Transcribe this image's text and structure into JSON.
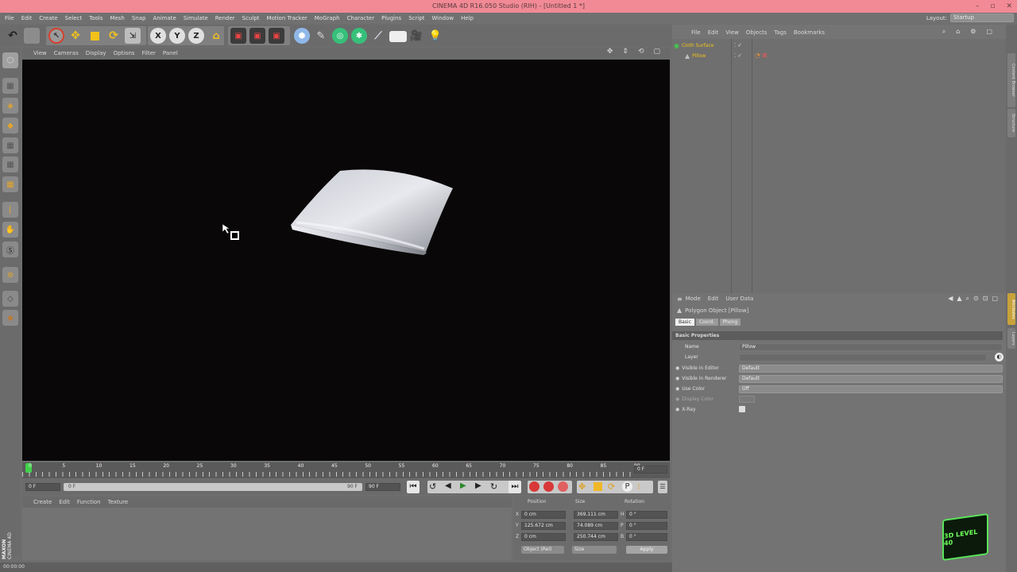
{
  "titlebar": {
    "title": "CINEMA 4D R16.050 Studio (RIH) - [Untitled 1 *]"
  },
  "window_buttons": [
    "–",
    "▫",
    "✕"
  ],
  "menubar": [
    "File",
    "Edit",
    "Create",
    "Select",
    "Tools",
    "Mesh",
    "Snap",
    "Animate",
    "Simulate",
    "Render",
    "Sculpt",
    "Motion Tracker",
    "MoGraph",
    "Character",
    "Plugins",
    "Script",
    "Window",
    "Help"
  ],
  "layout": {
    "label": "Layout:",
    "value": "Startup"
  },
  "toolbar": {
    "undo_icon": "undo-icon",
    "axis_labels": [
      "X",
      "Y",
      "Z"
    ]
  },
  "viewport_menu": [
    "View",
    "Cameras",
    "Display",
    "Options",
    "Filter",
    "Panel"
  ],
  "timeline": {
    "ticks": [
      "0",
      "5",
      "10",
      "15",
      "20",
      "25",
      "30",
      "35",
      "40",
      "45",
      "50",
      "55",
      "60",
      "65",
      "70",
      "75",
      "80",
      "85",
      "90"
    ],
    "end_label": "0 F"
  },
  "anim": {
    "start": "0 F",
    "range_start": "0 F",
    "range_end": "90 F",
    "end": "90 F"
  },
  "material_menu": [
    "Create",
    "Edit",
    "Function",
    "Texture"
  ],
  "coords": {
    "headers": [
      "Position",
      "Size",
      "Rotation"
    ],
    "rows": [
      {
        "axis": "X",
        "pos": "0 cm",
        "size": "369.111 cm",
        "rot_axis": "H",
        "rot": "0 °"
      },
      {
        "axis": "Y",
        "pos": "125.672 cm",
        "size": "74.089 cm",
        "rot_axis": "P",
        "rot": "0 °"
      },
      {
        "axis": "Z",
        "pos": "0 cm",
        "size": "250.744 cm",
        "rot_axis": "B",
        "rot": "0 °"
      }
    ],
    "mode1": "Object (Rel)",
    "mode2": "Size",
    "apply": "Apply"
  },
  "status": {
    "time": "00:00:00"
  },
  "object_manager": {
    "menu": [
      "File",
      "Edit",
      "View",
      "Objects",
      "Tags",
      "Bookmarks"
    ],
    "objects": [
      {
        "name": "Cloth Surface",
        "level": 0
      },
      {
        "name": "Pillow",
        "level": 1
      }
    ]
  },
  "attributes": {
    "menu": [
      "Mode",
      "Edit",
      "User Data"
    ],
    "title": "Polygon Object [Pillow]",
    "tabs": [
      "Basic",
      "Coord.",
      "Phong"
    ],
    "section": "Basic Properties",
    "fields": [
      {
        "label": "Name",
        "value": "Pillow"
      },
      {
        "label": "Layer",
        "value": ""
      },
      {
        "label": "Visible in Editor",
        "value": "Default"
      },
      {
        "label": "Visible in Renderer",
        "value": "Default"
      },
      {
        "label": "Use Color",
        "value": "Off"
      },
      {
        "label": "Display Color",
        "value": ""
      },
      {
        "label": "X-Ray",
        "value": ""
      }
    ]
  },
  "side_tabs": [
    "Content Browser",
    "Structure",
    "Attributes",
    "Layers"
  ],
  "branding": {
    "maxon": "MAXON",
    "c4d": "CINEMA 4D"
  },
  "badge": {
    "text": "3D LEVEL 40"
  }
}
